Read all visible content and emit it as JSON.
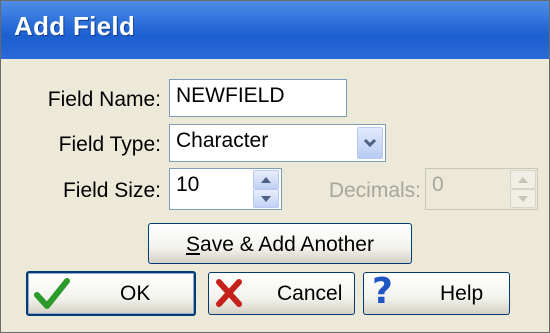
{
  "window": {
    "title": "Add Field"
  },
  "form": {
    "field_name_label": "Field Name:",
    "field_name_value": "NEWFIELD",
    "field_type_label": "Field Type:",
    "field_type_value": "Character",
    "field_size_label": "Field Size:",
    "field_size_value": "10",
    "decimals_label": "Decimals:",
    "decimals_value": "0"
  },
  "buttons": {
    "save_add_another_first": "S",
    "save_add_another_rest": "ave & Add Another",
    "ok": "OK",
    "cancel": "Cancel",
    "help": "Help"
  },
  "colors": {
    "titlebar": "#2a6ad9",
    "dialog_bg": "#ece9d8",
    "ok_check": "#2a9a2a",
    "cancel_x": "#c4211b",
    "help_q": "#1f56c4"
  },
  "icons": [
    "check-icon",
    "x-icon",
    "question-icon",
    "chevron-down-icon",
    "spin-up-icon",
    "spin-down-icon"
  ]
}
